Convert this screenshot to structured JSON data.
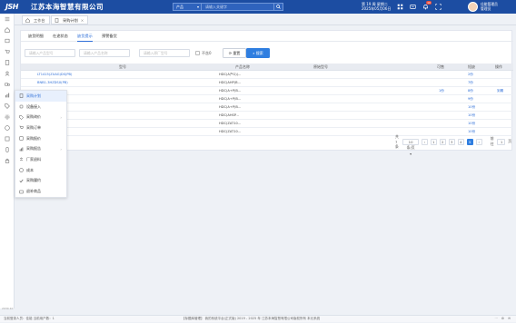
{
  "header": {
    "logo": "JSH",
    "company": "江苏本海智慧有限公司",
    "search_type": "产品",
    "search_placeholder": "请输入关键字",
    "date_line1": "第 19 周  星期二",
    "date_line2": "2025年05月06日",
    "bell_badge": "10",
    "user_name": "佳能管理员",
    "user_role": "管理员"
  },
  "tabs": [
    {
      "label": "工作台",
      "icon": "home-icon"
    },
    {
      "label": "采购计划",
      "icon": "doc-icon",
      "close": "×"
    }
  ],
  "subtabs": [
    "缺货明细",
    "在途状态",
    "缺货提示",
    "预警备货"
  ],
  "active_subtab": 2,
  "filters": {
    "product_code_placeholder": "请输入产品型号",
    "product_name_placeholder": "请输入产品名称",
    "original_code_placeholder": "请输入原厂型号",
    "checkbox_label": "不含0",
    "reset_label": "重置",
    "search_label": "搜索"
  },
  "table": {
    "headers": [
      "型号",
      "产品名称",
      "原始型号",
      "可售",
      "短缺",
      "操作"
    ],
    "rows": [
      {
        "code": "LT1415(ZUAG)DS(PB)",
        "name": "HDC(A产G)(...",
        "orig": "",
        "sale": "",
        "short": "2份",
        "op": ""
      },
      {
        "code": "BNB1-3HZDSX(PB)",
        "name": "HDC(AHP(B...",
        "orig": "",
        "sale": "",
        "short": "7份",
        "op": ""
      },
      {
        "code": "",
        "name": "HDC(A+P(B...",
        "orig": "",
        "sale": "1份",
        "short": "8份",
        "op": "到期"
      },
      {
        "code": "",
        "name": "HDC(A+P(B...",
        "orig": "",
        "sale": "",
        "short": "9份",
        "op": ""
      },
      {
        "code": "",
        "name": "HDC(A+P(B...",
        "orig": "",
        "sale": "",
        "short": "10份",
        "op": ""
      },
      {
        "code": "",
        "name": "HDC(AHSP...",
        "orig": "",
        "sale": "",
        "short": "10份",
        "op": ""
      },
      {
        "code": "",
        "name": "HDC(ZAT10...",
        "orig": "",
        "sale": "",
        "short": "10份",
        "op": ""
      },
      {
        "code": "",
        "name": "HDC(ZAT10...",
        "orig": "",
        "sale": "",
        "short": "10份",
        "op": ""
      }
    ]
  },
  "pager": {
    "total": "共7条",
    "size": "10条/页",
    "pages": [
      "1",
      "2",
      "3",
      "4",
      "5"
    ],
    "current": "5",
    "goto": "前往",
    "goto_page": "1",
    "page_unit": "页"
  },
  "dropdown": [
    {
      "label": "采购计划",
      "icon": "doc-icon",
      "active": true
    },
    {
      "label": "设备接入",
      "icon": "plug-icon"
    },
    {
      "label": "采购询价",
      "icon": "tag-icon",
      "chevron": "›"
    },
    {
      "label": "采购订单",
      "icon": "cart-icon"
    },
    {
      "label": "采购报价",
      "icon": "quote-icon"
    },
    {
      "label": "采购报告",
      "icon": "chart-icon",
      "chevron": "›"
    },
    {
      "label": "厂家退料",
      "icon": "return-icon"
    },
    {
      "label": "成本",
      "icon": "coin-icon"
    },
    {
      "label": "采购履约",
      "icon": "check-icon"
    },
    {
      "label": "退补商品",
      "icon": "box-icon"
    }
  ],
  "footer": {
    "left": "当前登录人员：佳能",
    "left2": "当前用户数：1",
    "center": "【标题库管理】 我的系统平台(正式版)  2019 - 2025 年 江苏本海智慧有限公司版权所有 本元系统",
    "right": [
      "⋯",
      "⚙",
      "✉"
    ]
  },
  "status_mark": "2030.10"
}
